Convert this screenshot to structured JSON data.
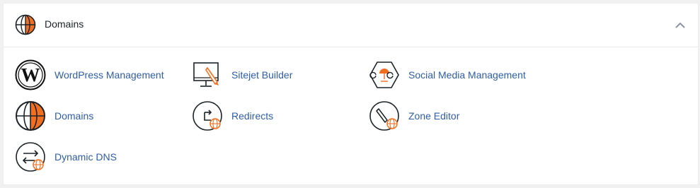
{
  "section": {
    "title": "Domains",
    "header_icon": "globe-icon",
    "collapse_icon": "chevron-up-icon",
    "items": [
      {
        "label": "WordPress Management",
        "icon": "wordpress-icon"
      },
      {
        "label": "Sitejet Builder",
        "icon": "sitejet-monitor-icon"
      },
      {
        "label": "Social Media Management",
        "icon": "social-media-icon"
      },
      {
        "label": "Domains",
        "icon": "globe-icon"
      },
      {
        "label": "Redirects",
        "icon": "redirect-icon"
      },
      {
        "label": "Zone Editor",
        "icon": "zone-editor-icon"
      },
      {
        "label": "Dynamic DNS",
        "icon": "dynamic-dns-icon"
      }
    ]
  },
  "colors": {
    "link": "#2e5ea7",
    "accent": "#f26f21",
    "icon_stroke": "#1c2328"
  }
}
